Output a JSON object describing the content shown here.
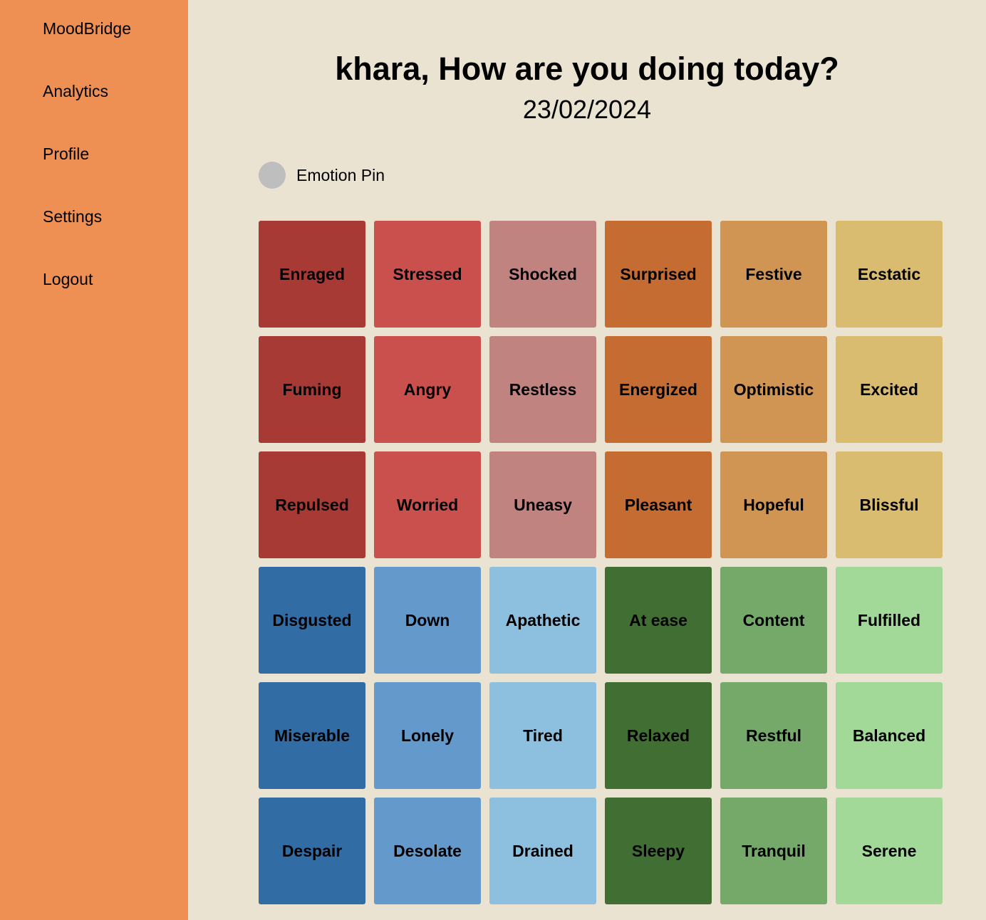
{
  "sidebar": {
    "items": [
      {
        "label": "MoodBridge"
      },
      {
        "label": "Analytics"
      },
      {
        "label": "Profile"
      },
      {
        "label": "Settings"
      },
      {
        "label": "Logout"
      }
    ]
  },
  "header": {
    "greeting": "khara, How are you doing today?",
    "date": "23/02/2024"
  },
  "pin": {
    "label": "Emotion Pin",
    "color": "#bebebe"
  },
  "colors": {
    "sidebar": "#ee8f54",
    "background": "#ebe3d2"
  },
  "emotions": [
    [
      "Enraged",
      "Stressed",
      "Shocked",
      "Surprised",
      "Festive",
      "Ecstatic"
    ],
    [
      "Fuming",
      "Angry",
      "Restless",
      "Energized",
      "Optimistic",
      "Excited"
    ],
    [
      "Repulsed",
      "Worried",
      "Uneasy",
      "Pleasant",
      "Hopeful",
      "Blissful"
    ],
    [
      "Disgusted",
      "Down",
      "Apathetic",
      "At ease",
      "Content",
      "Fulfilled"
    ],
    [
      "Miserable",
      "Lonely",
      "Tired",
      "Relaxed",
      "Restful",
      "Balanced"
    ],
    [
      "Despair",
      "Desolate",
      "Drained",
      "Sleepy",
      "Tranquil",
      "Serene"
    ]
  ],
  "tile_colors": {
    "top": [
      "#a83a36",
      "#c9504d",
      "#c08380",
      "#c46c31",
      "#d19553",
      "#d9bc6f"
    ],
    "bottom": [
      "#316ca4",
      "#6499cc",
      "#8dbfdf",
      "#416f33",
      "#74a96a",
      "#a2d898"
    ]
  }
}
